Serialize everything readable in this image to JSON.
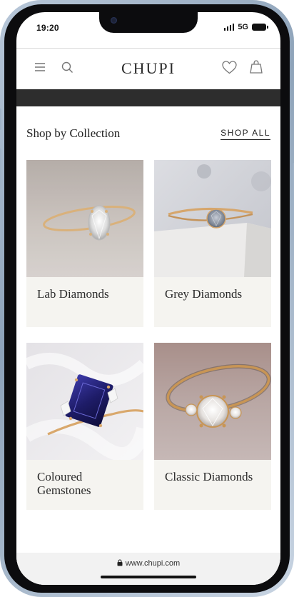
{
  "status": {
    "time": "19:20",
    "network": "5G"
  },
  "header": {
    "logo": "CHUPI",
    "icons": [
      "menu-icon",
      "search-icon",
      "heart-icon",
      "bag-icon"
    ]
  },
  "section": {
    "title": "Shop by Collection",
    "shop_all": "SHOP ALL"
  },
  "collections": [
    {
      "label": "Lab Diamonds"
    },
    {
      "label": "Grey Diamonds"
    },
    {
      "label": "Coloured Gemstones"
    },
    {
      "label": "Classic Diamonds"
    }
  ],
  "browser": {
    "url": "www.chupi.com"
  },
  "colors": {
    "banner": "#2d2d2d",
    "card_bg": "#f5f4f0",
    "gold": "#d9a86c",
    "sapphire": "#25237a"
  }
}
